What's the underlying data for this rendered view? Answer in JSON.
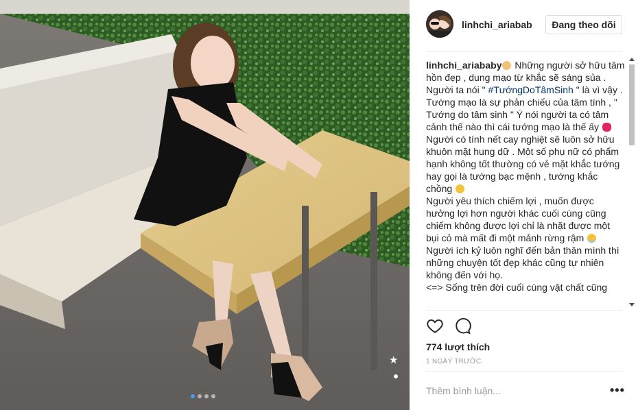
{
  "post": {
    "photo": {
      "dots": [
        {
          "active": true
        },
        {
          "active": false
        },
        {
          "active": false
        },
        {
          "active": false
        }
      ]
    },
    "header": {
      "username": "linhchi_ariababy",
      "follow_label": "Đang theo dõi"
    },
    "caption": {
      "username": "linhchi_ariababy",
      "lines": [
        {
          "pre": " Những người sở hữu tâm hồn đẹp , dung mạo từ khắc sẽ sáng sủa . Người ta nói \" ",
          "hashtag": "#TướngDoTâmSinh",
          "post": " \" là vì vậy ."
        },
        {
          "text": "Tướng mạo là sự phản chiếu của tâm tính , \" Tướng do tâm sinh \" Ý nói người ta có tâm cảnh thế nào thì cái tướng mạo là thế ấy "
        },
        {
          "text": "Người có tính nết cay nghiệt sẽ luôn sở hữu khuôn mặt hung dữ . Một số phụ nữ có phẩm hạnh không tốt thường có vẻ mặt khắc tướng hay gọi là tướng bạc mệnh , tướng khắc chồng "
        },
        {
          "text": "Người yêu thích chiếm lợi , muốn được hưởng lợi hơn người khác cuối cùng cũng chiếm không được lợi chỉ là nhặt được một bụi cỏ mà mất đi một mảnh rừng rậm "
        },
        {
          "text": "Người ích kỷ luôn nghĩ đến bản thân mình thì những chuyện tốt đẹp khác cũng tự nhiên không đến với họ."
        },
        {
          "text": "<=> Sống trên đời cuối cùng vật chất cũng"
        }
      ],
      "emoji": [
        "hands-emoji",
        "lips-emoji",
        "grin-emoji",
        "halo-emoji"
      ]
    },
    "likes": "774 lượt thích",
    "timestamp": "1 ngày trước",
    "comment_placeholder": "Thêm bình luận...",
    "more_label": "•••"
  },
  "colors": {
    "hashtag": "#003569",
    "text": "#262626",
    "muted": "#999999",
    "divider": "#efefef"
  }
}
